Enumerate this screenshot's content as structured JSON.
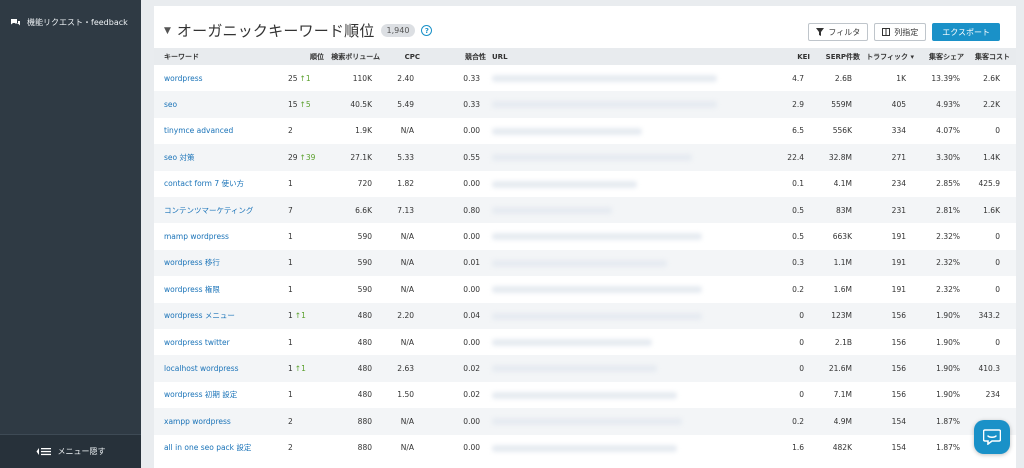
{
  "sidebar": {
    "feedback_label": "機能リクエスト・feedback",
    "collapse_label": "メニュー隠す"
  },
  "header": {
    "title": "オーガニックキーワード順位",
    "count": "1,940",
    "help_glyph": "?",
    "filter_label": "フィルタ",
    "columns_label": "列指定",
    "export_label": "エクスポート"
  },
  "table": {
    "headers": [
      "キーワード",
      "順位",
      "検索ボリューム",
      "CPC",
      "競合性",
      "URL",
      "KEI",
      "SERP件数",
      "トラフィック ▾",
      "集客シェア",
      "集客コスト"
    ],
    "rows": [
      {
        "keyword": "wordpress",
        "rank": "25",
        "change": "1",
        "volume": "110K",
        "cpc": "2.40",
        "comp": "0.33",
        "kei": "4.7",
        "serp": "2.6B",
        "traffic": "1K",
        "share": "13.39%",
        "cost": "2.6K"
      },
      {
        "keyword": "seo",
        "rank": "15",
        "change": "5",
        "volume": "40.5K",
        "cpc": "5.49",
        "comp": "0.33",
        "kei": "2.9",
        "serp": "559M",
        "traffic": "405",
        "share": "4.93%",
        "cost": "2.2K"
      },
      {
        "keyword": "tinymce advanced",
        "rank": "2",
        "change": "",
        "volume": "1.9K",
        "cpc": "N/A",
        "comp": "0.00",
        "kei": "6.5",
        "serp": "556K",
        "traffic": "334",
        "share": "4.07%",
        "cost": "0"
      },
      {
        "keyword": "seo 対策",
        "rank": "29",
        "change": "39",
        "volume": "27.1K",
        "cpc": "5.33",
        "comp": "0.55",
        "kei": "22.4",
        "serp": "32.8M",
        "traffic": "271",
        "share": "3.30%",
        "cost": "1.4K"
      },
      {
        "keyword": "contact form 7 使い方",
        "rank": "1",
        "change": "",
        "volume": "720",
        "cpc": "1.82",
        "comp": "0.00",
        "kei": "0.1",
        "serp": "4.1M",
        "traffic": "234",
        "share": "2.85%",
        "cost": "425.9"
      },
      {
        "keyword": "コンテンツマーケティング",
        "rank": "7",
        "change": "",
        "volume": "6.6K",
        "cpc": "7.13",
        "comp": "0.80",
        "kei": "0.5",
        "serp": "83M",
        "traffic": "231",
        "share": "2.81%",
        "cost": "1.6K"
      },
      {
        "keyword": "mamp wordpress",
        "rank": "1",
        "change": "",
        "volume": "590",
        "cpc": "N/A",
        "comp": "0.00",
        "kei": "0.5",
        "serp": "663K",
        "traffic": "191",
        "share": "2.32%",
        "cost": "0"
      },
      {
        "keyword": "wordpress 移行",
        "rank": "1",
        "change": "",
        "volume": "590",
        "cpc": "N/A",
        "comp": "0.01",
        "kei": "0.3",
        "serp": "1.1M",
        "traffic": "191",
        "share": "2.32%",
        "cost": "0"
      },
      {
        "keyword": "wordpress 権限",
        "rank": "1",
        "change": "",
        "volume": "590",
        "cpc": "N/A",
        "comp": "0.00",
        "kei": "0.2",
        "serp": "1.6M",
        "traffic": "191",
        "share": "2.32%",
        "cost": "0"
      },
      {
        "keyword": "wordpress メニュー",
        "rank": "1",
        "change": "1",
        "volume": "480",
        "cpc": "2.20",
        "comp": "0.04",
        "kei": "0",
        "serp": "123M",
        "traffic": "156",
        "share": "1.90%",
        "cost": "343.2"
      },
      {
        "keyword": "wordpress twitter",
        "rank": "1",
        "change": "",
        "volume": "480",
        "cpc": "N/A",
        "comp": "0.00",
        "kei": "0",
        "serp": "2.1B",
        "traffic": "156",
        "share": "1.90%",
        "cost": "0"
      },
      {
        "keyword": "localhost wordpress",
        "rank": "1",
        "change": "1",
        "volume": "480",
        "cpc": "2.63",
        "comp": "0.02",
        "kei": "0",
        "serp": "21.6M",
        "traffic": "156",
        "share": "1.90%",
        "cost": "410.3"
      },
      {
        "keyword": "wordpress 初期 設定",
        "rank": "1",
        "change": "",
        "volume": "480",
        "cpc": "1.50",
        "comp": "0.02",
        "kei": "0",
        "serp": "7.1M",
        "traffic": "156",
        "share": "1.90%",
        "cost": "234"
      },
      {
        "keyword": "xampp wordpress",
        "rank": "2",
        "change": "",
        "volume": "880",
        "cpc": "N/A",
        "comp": "0.00",
        "kei": "0.2",
        "serp": "4.9M",
        "traffic": "154",
        "share": "1.87%",
        "cost": ""
      },
      {
        "keyword": "all in one seo pack 設定",
        "rank": "2",
        "change": "",
        "volume": "880",
        "cpc": "N/A",
        "comp": "0.00",
        "kei": "1.6",
        "serp": "482K",
        "traffic": "154",
        "share": "1.87%",
        "cost": ""
      }
    ]
  },
  "colors": {
    "accent": "#1a91c8",
    "sidebar": "#2f3a44",
    "link": "#1a73b8",
    "up": "#5aa02c"
  },
  "icons": {
    "feedback": "chat-bubbles-icon",
    "collapse": "menu-collapse-icon",
    "filter": "funnel-icon",
    "columns": "columns-icon",
    "chat": "chat-widget-icon",
    "up": "up-arrow-icon"
  }
}
